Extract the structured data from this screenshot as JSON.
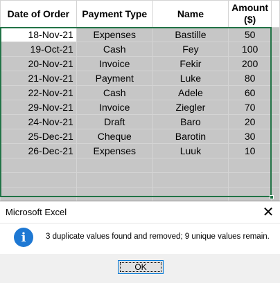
{
  "sheet": {
    "headers": [
      {
        "line1": "Date of Order",
        "line2": ""
      },
      {
        "line1": "Payment Type",
        "line2": ""
      },
      {
        "line1": "Name",
        "line2": ""
      },
      {
        "line1": "Amount",
        "line2": "($)"
      }
    ],
    "rows": [
      {
        "date": "18-Nov-21",
        "type": "Expenses",
        "name": "Bastille",
        "amount": "50"
      },
      {
        "date": "19-Oct-21",
        "type": "Cash",
        "name": "Fey",
        "amount": "100"
      },
      {
        "date": "20-Nov-21",
        "type": "Invoice",
        "name": "Fekir",
        "amount": "200"
      },
      {
        "date": "21-Nov-21",
        "type": "Payment",
        "name": "Luke",
        "amount": "80"
      },
      {
        "date": "22-Nov-21",
        "type": "Cash",
        "name": "Adele",
        "amount": "60"
      },
      {
        "date": "29-Nov-21",
        "type": "Invoice",
        "name": "Ziegler",
        "amount": "70"
      },
      {
        "date": "24-Nov-21",
        "type": "Draft",
        "name": "Baro",
        "amount": "20"
      },
      {
        "date": "25-Dec-21",
        "type": "Cheque",
        "name": "Barotin",
        "amount": "30"
      },
      {
        "date": "26-Dec-21",
        "type": "Expenses",
        "name": "Luuk",
        "amount": "10"
      }
    ],
    "selection_color": "#217346"
  },
  "dialog": {
    "title": "Microsoft Excel",
    "close_glyph": "✕",
    "icon": "info-icon",
    "icon_glyph": "i",
    "message": "3 duplicate values found and removed; 9 unique values remain.",
    "ok_label": "OK"
  }
}
